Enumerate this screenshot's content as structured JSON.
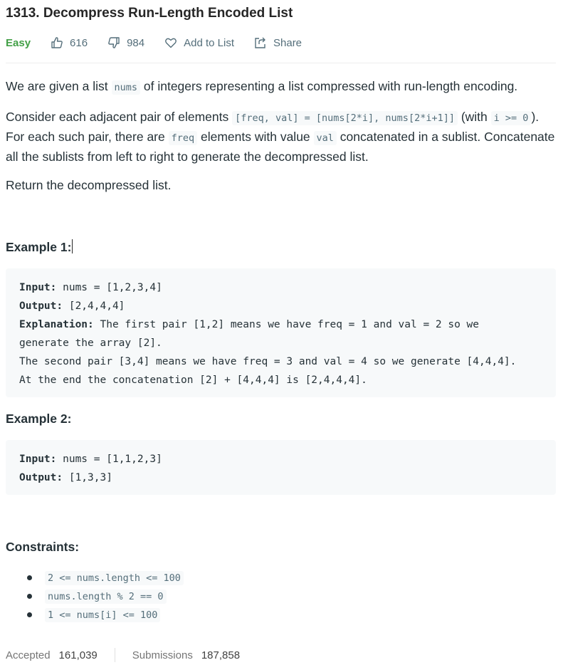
{
  "problem": {
    "title": "1313. Decompress Run-Length Encoded List"
  },
  "meta": {
    "difficulty": "Easy",
    "likes": "616",
    "dislikes": "984",
    "add_to_list": "Add to List",
    "share": "Share",
    "difficulty_color": "#43a047"
  },
  "description": {
    "p1_a": "We are given a list ",
    "p1_code": "nums",
    "p1_b": " of integers representing a list compressed with run-length encoding.",
    "p2_a": "Consider each adjacent pair of elements ",
    "p2_code1": "[freq, val] = [nums[2*i], nums[2*i+1]]",
    "p2_b": " (with ",
    "p2_code2": "i >= 0",
    "p2_c": "). For each such pair, there are ",
    "p2_code3": "freq",
    "p2_d": " elements with value ",
    "p2_code4": "val",
    "p2_e": " concatenated in a sublist. Concatenate all the sublists from left to right to generate the decompressed list.",
    "p3": "Return the decompressed list."
  },
  "example1": {
    "heading": "Example 1:",
    "input_label": "Input:",
    "input_value": " nums = [1,2,3,4]",
    "output_label": "Output:",
    "output_value": " [2,4,4,4]",
    "explanation_label": "Explanation:",
    "explanation_l1": " The first pair [1,2] means we have freq = 1 and val = 2 so we",
    "explanation_l2": "generate the array [2].",
    "explanation_l3": "The second pair [3,4] means we have freq = 3 and val = 4 so we generate [4,4,4].",
    "explanation_l4": "At the end the concatenation [2] + [4,4,4] is [2,4,4,4]."
  },
  "example2": {
    "heading": "Example 2:",
    "input_label": "Input:",
    "input_value": " nums = [1,1,2,3]",
    "output_label": "Output:",
    "output_value": " [1,3,3]"
  },
  "constraints": {
    "heading": "Constraints:",
    "items": [
      "2 <= nums.length <= 100",
      "nums.length % 2 == 0",
      "1 <= nums[i] <= 100"
    ]
  },
  "stats": {
    "accepted_label": "Accepted",
    "accepted_value": "161,039",
    "submissions_label": "Submissions",
    "submissions_value": "187,858"
  }
}
